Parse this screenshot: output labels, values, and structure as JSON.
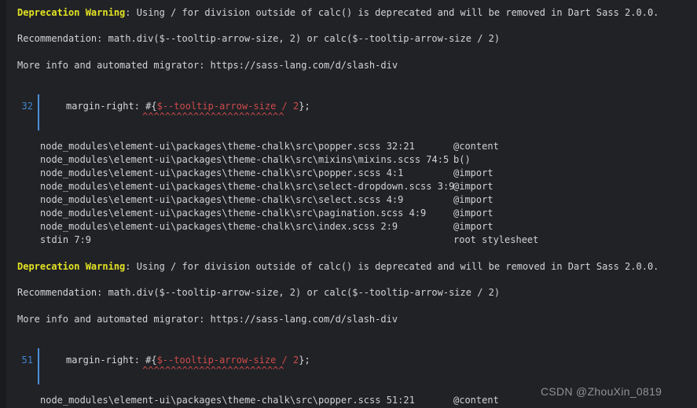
{
  "terminal": {
    "background_color": "#212226",
    "foreground_color": "#cfd2d4",
    "warning_color": "#e3e324",
    "code_highlight_color": "#cd4b4b",
    "lineno_color": "#3f86d0",
    "gutter_bar_color": "#4a90d9"
  },
  "blocks": [
    {
      "severity_label": "Deprecation Warning",
      "separator": ":",
      "message": " Using / for division outside of calc() is deprecated and will be removed in Dart Sass 2.0.0.",
      "recommendation": "Recommendation: math.div($--tooltip-arrow-size, 2) or calc($--tooltip-arrow-size / 2)",
      "more_info": "More info and automated migrator: https://sass-lang.com/d/slash-div",
      "code": {
        "line_number": "32",
        "prefix": "margin-right: #{",
        "expression": "$--tooltip-arrow-size / 2",
        "suffix": "};",
        "carets": "^^^^^^^^^^^^^^^^^^^^^^^^^"
      },
      "trace": [
        {
          "path": "node_modules\\element-ui\\packages\\theme-chalk\\src\\popper.scss 32:21",
          "kind": "@content"
        },
        {
          "path": "node_modules\\element-ui\\packages\\theme-chalk\\src\\mixins\\mixins.scss 74:5",
          "kind": "b()"
        },
        {
          "path": "node_modules\\element-ui\\packages\\theme-chalk\\src\\popper.scss 4:1",
          "kind": "@import"
        },
        {
          "path": "node_modules\\element-ui\\packages\\theme-chalk\\src\\select-dropdown.scss 3:9",
          "kind": "@import"
        },
        {
          "path": "node_modules\\element-ui\\packages\\theme-chalk\\src\\select.scss 4:9",
          "kind": "@import"
        },
        {
          "path": "node_modules\\element-ui\\packages\\theme-chalk\\src\\pagination.scss 4:9",
          "kind": "@import"
        },
        {
          "path": "node_modules\\element-ui\\packages\\theme-chalk\\src\\index.scss 2:9",
          "kind": "@import"
        },
        {
          "path": "stdin 7:9",
          "kind": "root stylesheet"
        }
      ]
    },
    {
      "severity_label": "Deprecation Warning",
      "separator": ":",
      "message": " Using / for division outside of calc() is deprecated and will be removed in Dart Sass 2.0.0.",
      "recommendation": "Recommendation: math.div($--tooltip-arrow-size, 2) or calc($--tooltip-arrow-size / 2)",
      "more_info": "More info and automated migrator: https://sass-lang.com/d/slash-div",
      "code": {
        "line_number": "51",
        "prefix": "margin-right: #{",
        "expression": "$--tooltip-arrow-size / 2",
        "suffix": "};",
        "carets": "^^^^^^^^^^^^^^^^^^^^^^^^^"
      },
      "trace": [
        {
          "path": "node_modules\\element-ui\\packages\\theme-chalk\\src\\popper.scss 51:21",
          "kind": "@content"
        }
      ]
    }
  ],
  "watermark": "CSDN @ZhouXin_0819"
}
